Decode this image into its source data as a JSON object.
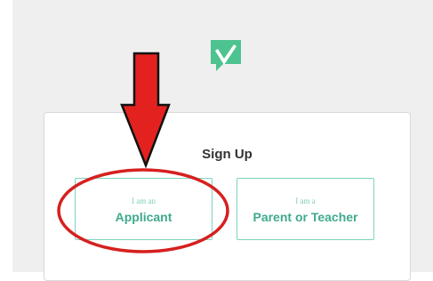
{
  "logo": {
    "icon": "checkmark-logo-icon",
    "color": "#4dc38f"
  },
  "signup": {
    "title": "Sign Up",
    "options": [
      {
        "prefix": "I am an",
        "label": "Applicant"
      },
      {
        "prefix": "I am a",
        "label": "Parent or Teacher"
      }
    ]
  },
  "annotation": {
    "arrow_icon": "red-down-arrow-icon",
    "circle_icon": "red-highlight-ellipse",
    "color": "#d6201f"
  }
}
